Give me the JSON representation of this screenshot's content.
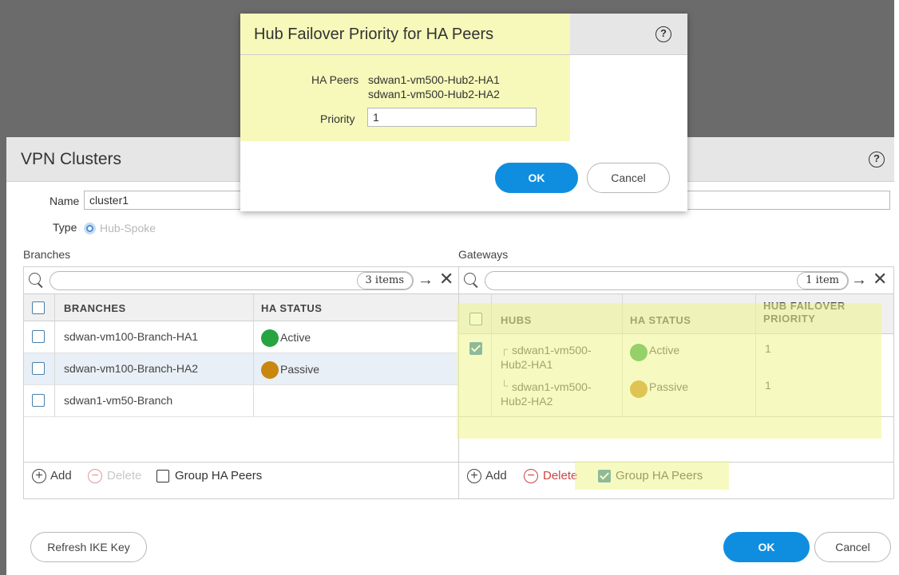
{
  "main_dialog": {
    "title": "VPN Clusters",
    "name_label": "Name",
    "name_value": "cluster1",
    "type_label": "Type",
    "type_value": "Hub-Spoke",
    "branches": {
      "section_label": "Branches",
      "item_count": "3 items",
      "columns": [
        "BRANCHES",
        "HA STATUS"
      ],
      "rows": [
        {
          "name": "sdwan-vm100-Branch-HA1",
          "status": "Active",
          "status_color": "#27a340",
          "checked": false,
          "selected": false
        },
        {
          "name": "sdwan-vm100-Branch-HA2",
          "status": "Passive",
          "status_color": "#c9870f",
          "checked": false,
          "selected": true
        },
        {
          "name": "sdwan1-vm50-Branch",
          "status": "",
          "status_color": "",
          "checked": false,
          "selected": false
        }
      ],
      "add_label": "Add",
      "delete_label": "Delete",
      "group_label": "Group HA Peers",
      "group_checked": false
    },
    "gateways": {
      "section_label": "Gateways",
      "item_count": "1 item",
      "columns": [
        "HUBS",
        "HA STATUS",
        "HUB FAILOVER",
        "PRIORITY"
      ],
      "rows": [
        {
          "name_line1": "sdwan1-vm500-",
          "name_line2": "Hub2-HA1",
          "status": "Active",
          "status_color": "#27a340",
          "priority": "1",
          "checked": true
        },
        {
          "name_line1": "sdwan1-vm500-",
          "name_line2": "Hub2-HA2",
          "status": "Passive",
          "status_color": "#c9870f",
          "priority": "1",
          "checked": false
        }
      ],
      "add_label": "Add",
      "delete_label": "Delete",
      "group_label": "Group HA Peers",
      "group_checked": true
    },
    "refresh_label": "Refresh IKE Key",
    "ok_label": "OK",
    "cancel_label": "Cancel"
  },
  "modal": {
    "title": "Hub Failover Priority for HA Peers",
    "ha_peers_label": "HA Peers",
    "ha_peer_1": "sdwan1-vm500-Hub2-HA1",
    "ha_peer_2": "sdwan1-vm500-Hub2-HA2",
    "priority_label": "Priority",
    "priority_value": "1",
    "ok_label": "OK",
    "cancel_label": "Cancel"
  },
  "icons": {
    "help": "help-icon",
    "search": "search-icon",
    "apply_filter": "arrow-right-icon",
    "clear_filter": "close-icon",
    "add": "add-circle-icon",
    "delete": "delete-circle-icon",
    "tree_branch": "tree-connector-icon"
  },
  "colors": {
    "accent": "#0f8ee0",
    "active": "#27a340",
    "passive": "#c9870f",
    "highlight": "#f0f58c"
  }
}
